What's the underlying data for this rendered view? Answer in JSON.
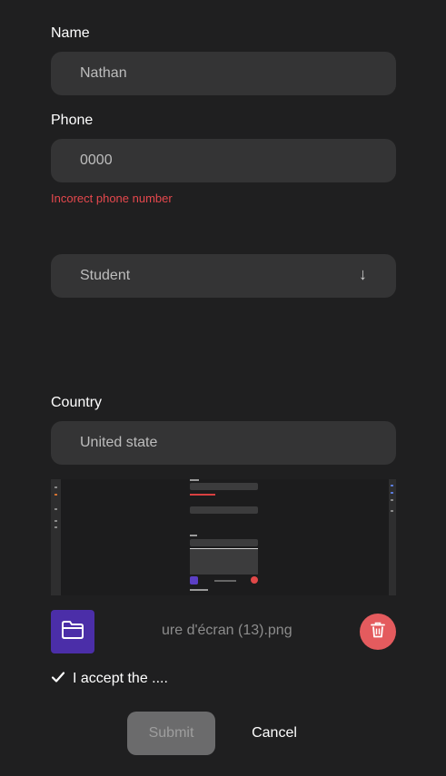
{
  "form": {
    "name_label": "Name",
    "name_value": "Nathan",
    "phone_label": "Phone",
    "phone_value": "0000",
    "phone_error": "Incorect phone number",
    "role_value": "Student",
    "role_arrow": "↓",
    "country_label": "Country",
    "country_value": "United state",
    "file_name": "ure d'écran (13).png",
    "accept_label": "I accept the ....",
    "submit_label": "Submit",
    "cancel_label": "Cancel"
  },
  "icons": {
    "folder": "folder-icon",
    "delete": "trash-icon",
    "check": "check-icon",
    "arrow": "arrow-down-icon"
  },
  "colors": {
    "background": "#1f1f20",
    "field": "#343435",
    "error": "#e5484d",
    "folder_button": "#4b2ea8",
    "delete_button": "#e45b5e",
    "submit_disabled": "#6b6b6c"
  }
}
